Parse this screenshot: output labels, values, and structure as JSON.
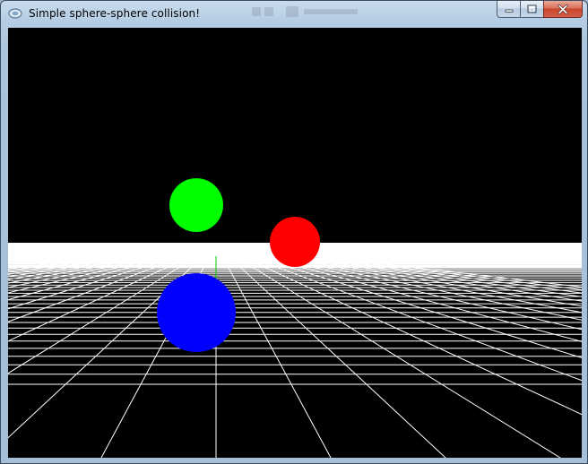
{
  "window": {
    "title": "Simple sphere-sphere collision!",
    "icon": "app-logo-icon",
    "caption_buttons": [
      "minimize-icon",
      "maximize-icon",
      "close-icon"
    ]
  },
  "scene": {
    "background_color": "#000000",
    "grid_color": "#ffffff",
    "axis_color": "#00cc00",
    "spheres": [
      {
        "name": "green-sphere",
        "color": "#00ff00"
      },
      {
        "name": "red-sphere",
        "color": "#ff0000"
      },
      {
        "name": "blue-sphere",
        "color": "#0000ff"
      }
    ]
  }
}
